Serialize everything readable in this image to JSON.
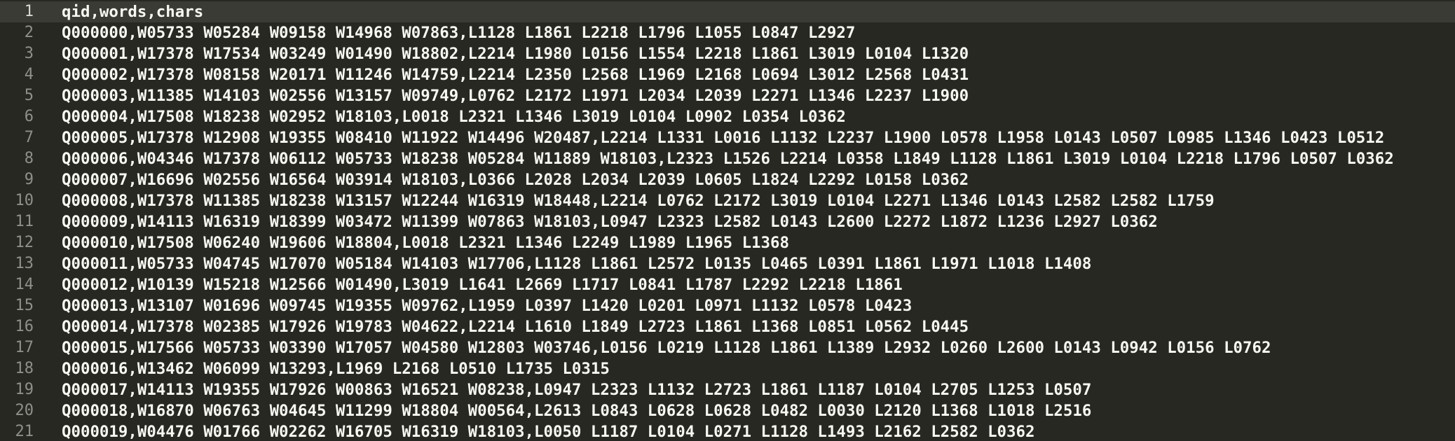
{
  "editor": {
    "theme_colors": {
      "background": "#272822",
      "text": "#f8f8f2",
      "line_number": "#8f908a",
      "current_line": "#3a3b34"
    },
    "lines": [
      {
        "number": "1",
        "text": "qid,words,chars"
      },
      {
        "number": "2",
        "text": "Q000000,W05733 W05284 W09158 W14968 W07863,L1128 L1861 L2218 L1796 L1055 L0847 L2927"
      },
      {
        "number": "3",
        "text": "Q000001,W17378 W17534 W03249 W01490 W18802,L2214 L1980 L0156 L1554 L2218 L1861 L3019 L0104 L1320"
      },
      {
        "number": "4",
        "text": "Q000002,W17378 W08158 W20171 W11246 W14759,L2214 L2350 L2568 L1969 L2168 L0694 L3012 L2568 L0431"
      },
      {
        "number": "5",
        "text": "Q000003,W11385 W14103 W02556 W13157 W09749,L0762 L2172 L1971 L2034 L2039 L2271 L1346 L2237 L1900"
      },
      {
        "number": "6",
        "text": "Q000004,W17508 W18238 W02952 W18103,L0018 L2321 L1346 L3019 L0104 L0902 L0354 L0362"
      },
      {
        "number": "7",
        "text": "Q000005,W17378 W12908 W19355 W08410 W11922 W14496 W20487,L2214 L1331 L0016 L1132 L2237 L1900 L0578 L1958 L0143 L0507 L0985 L1346 L0423 L0512"
      },
      {
        "number": "8",
        "text": "Q000006,W04346 W17378 W06112 W05733 W18238 W05284 W11889 W18103,L2323 L1526 L2214 L0358 L1849 L1128 L1861 L3019 L0104 L2218 L1796 L0507 L0362"
      },
      {
        "number": "9",
        "text": "Q000007,W16696 W02556 W16564 W03914 W18103,L0366 L2028 L2034 L2039 L0605 L1824 L2292 L0158 L0362"
      },
      {
        "number": "10",
        "text": "Q000008,W17378 W11385 W18238 W13157 W12244 W16319 W18448,L2214 L0762 L2172 L3019 L0104 L2271 L1346 L0143 L2582 L2582 L1759"
      },
      {
        "number": "11",
        "text": "Q000009,W14113 W16319 W18399 W03472 W11399 W07863 W18103,L0947 L2323 L2582 L0143 L2600 L2272 L1872 L1236 L2927 L0362"
      },
      {
        "number": "12",
        "text": "Q000010,W17508 W06240 W19606 W18804,L0018 L2321 L1346 L2249 L1989 L1965 L1368"
      },
      {
        "number": "13",
        "text": "Q000011,W05733 W04745 W17070 W05184 W14103 W17706,L1128 L1861 L2572 L0135 L0465 L0391 L1861 L1971 L1018 L1408"
      },
      {
        "number": "14",
        "text": "Q000012,W10139 W15218 W12566 W01490,L3019 L1641 L2669 L1717 L0841 L1787 L2292 L2218 L1861"
      },
      {
        "number": "15",
        "text": "Q000013,W13107 W01696 W09745 W19355 W09762,L1959 L0397 L1420 L0201 L0971 L1132 L0578 L0423"
      },
      {
        "number": "16",
        "text": "Q000014,W17378 W02385 W17926 W19783 W04622,L2214 L1610 L1849 L2723 L1861 L1368 L0851 L0562 L0445"
      },
      {
        "number": "17",
        "text": "Q000015,W17566 W05733 W03390 W17057 W04580 W12803 W03746,L0156 L0219 L1128 L1861 L1389 L2932 L0260 L2600 L0143 L0942 L0156 L0762"
      },
      {
        "number": "18",
        "text": "Q000016,W13462 W06099 W13293,L1969 L2168 L0510 L1735 L0315"
      },
      {
        "number": "19",
        "text": "Q000017,W14113 W19355 W17926 W00863 W16521 W08238,L0947 L2323 L1132 L2723 L1861 L1187 L0104 L2705 L1253 L0507"
      },
      {
        "number": "20",
        "text": "Q000018,W16870 W06763 W04645 W11299 W18804 W00564,L2613 L0843 L0628 L0628 L0482 L0030 L2120 L1368 L1018 L2516"
      },
      {
        "number": "21",
        "text": "Q000019,W04476 W01766 W02262 W16705 W16319 W18103,L0050 L1187 L0104 L0271 L1128 L1493 L2162 L2582 L0362"
      }
    ]
  }
}
